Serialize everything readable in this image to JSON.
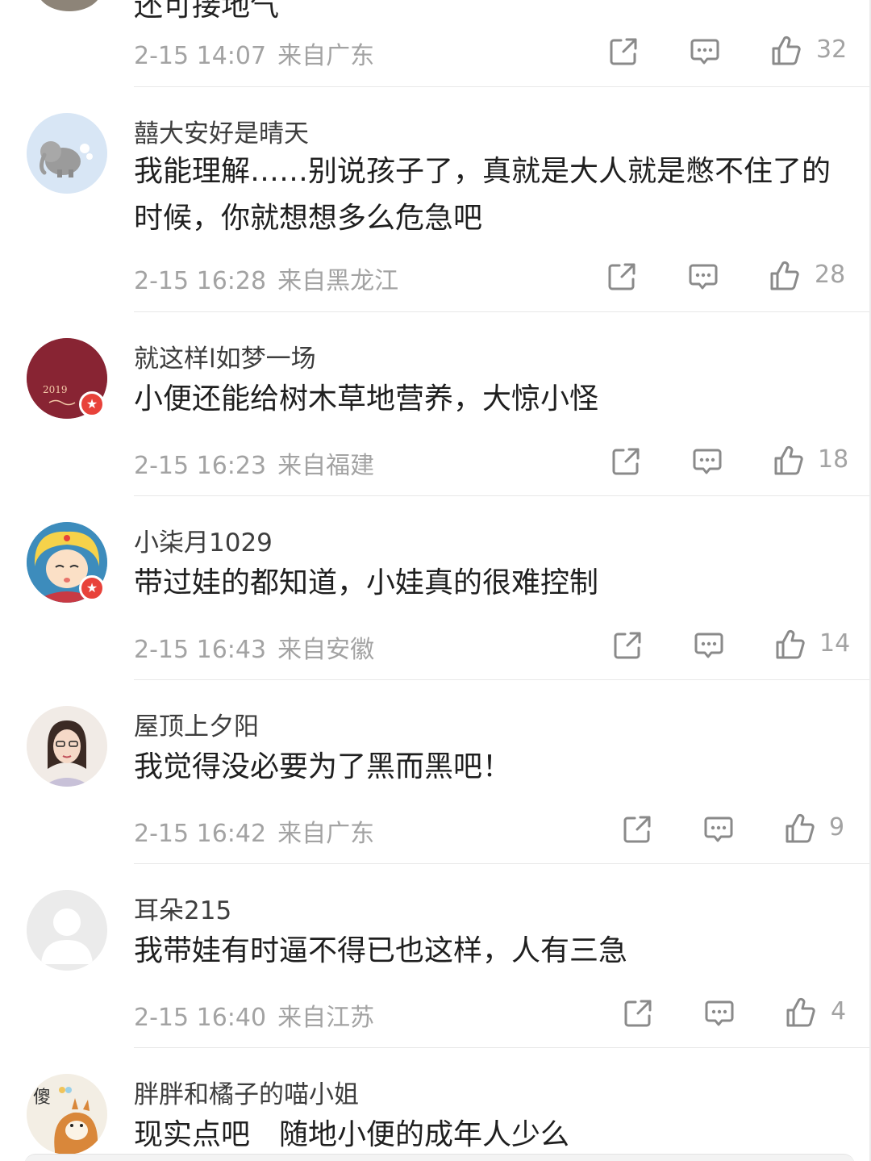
{
  "partial_top": {
    "text": "还可接地气"
  },
  "comments": [
    {
      "time": "2-15 14:07",
      "location": "来自广东",
      "likes": "32"
    },
    {
      "username": "囍大安好是晴天",
      "text": "我能理解……别说孩子了，真就是大人就是憋不住了的时候，你就想想多么危急吧",
      "time": "2-15 16:28",
      "location": "来自黑龙江",
      "likes": "28"
    },
    {
      "username": "就这样l如梦一场",
      "text": "小便还能给树木草地营养，大惊小怪",
      "time": "2-15 16:23",
      "location": "来自福建",
      "likes": "18",
      "avatar_text": "2019"
    },
    {
      "username": "小柒月1029",
      "text": "带过娃的都知道，小娃真的很难控制",
      "time": "2-15 16:43",
      "location": "来自安徽",
      "likes": "14"
    },
    {
      "username": "屋顶上夕阳",
      "text": "我觉得没必要为了黑而黑吧！",
      "time": "2-15 16:42",
      "location": "来自广东",
      "likes": "9"
    },
    {
      "username": "耳朵215",
      "text": "我带娃有时逼不得已也这样，人有三急",
      "time": "2-15 16:40",
      "location": "来自江苏",
      "likes": "4"
    },
    {
      "username": "胖胖和橘子的喵小姐",
      "text": "现实点吧　随地小便的成年人少么",
      "avatar_text": "傻"
    }
  ],
  "icons": {
    "share": "share-icon",
    "comment": "comment-icon",
    "like": "thumbs-up-icon",
    "badge": "verified-star-badge-icon"
  },
  "colors": {
    "meta_text": "#a3a3a3",
    "badge": "#e8423a",
    "divider": "#e8e8e8"
  }
}
